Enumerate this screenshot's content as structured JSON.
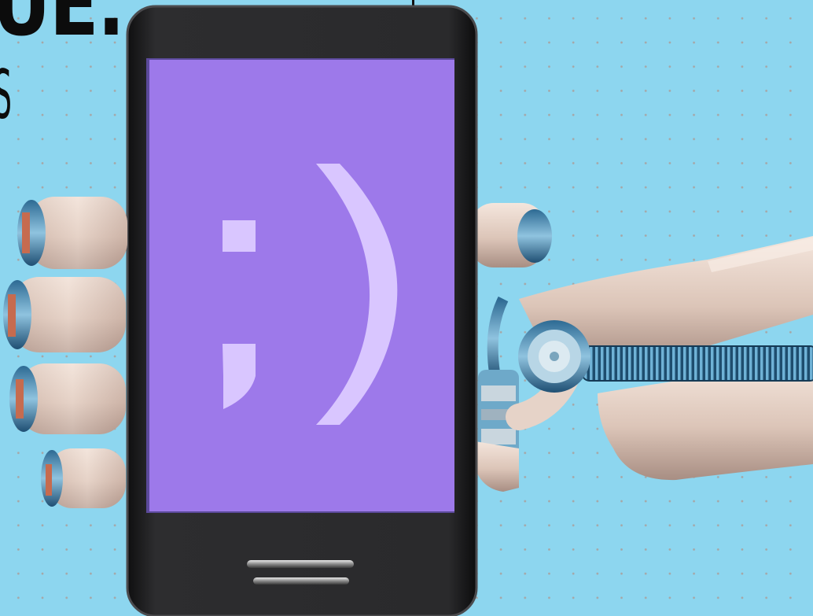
{
  "headline_fragment": "UE.",
  "subline_fragment": "S",
  "screen": {
    "emoticon_semicolon": ";",
    "emoticon_paren": ")"
  },
  "colors": {
    "background": "#8dd6ef",
    "screen": "#9d79ea",
    "emoticon": "#d9c6ff",
    "phone_body": "#1d1d1f",
    "robot_shell": "#e3cfc4",
    "robot_joint": "#3f7fa6"
  },
  "icons": [
    "robot-arm",
    "smartphone",
    "wink-emoticon"
  ]
}
